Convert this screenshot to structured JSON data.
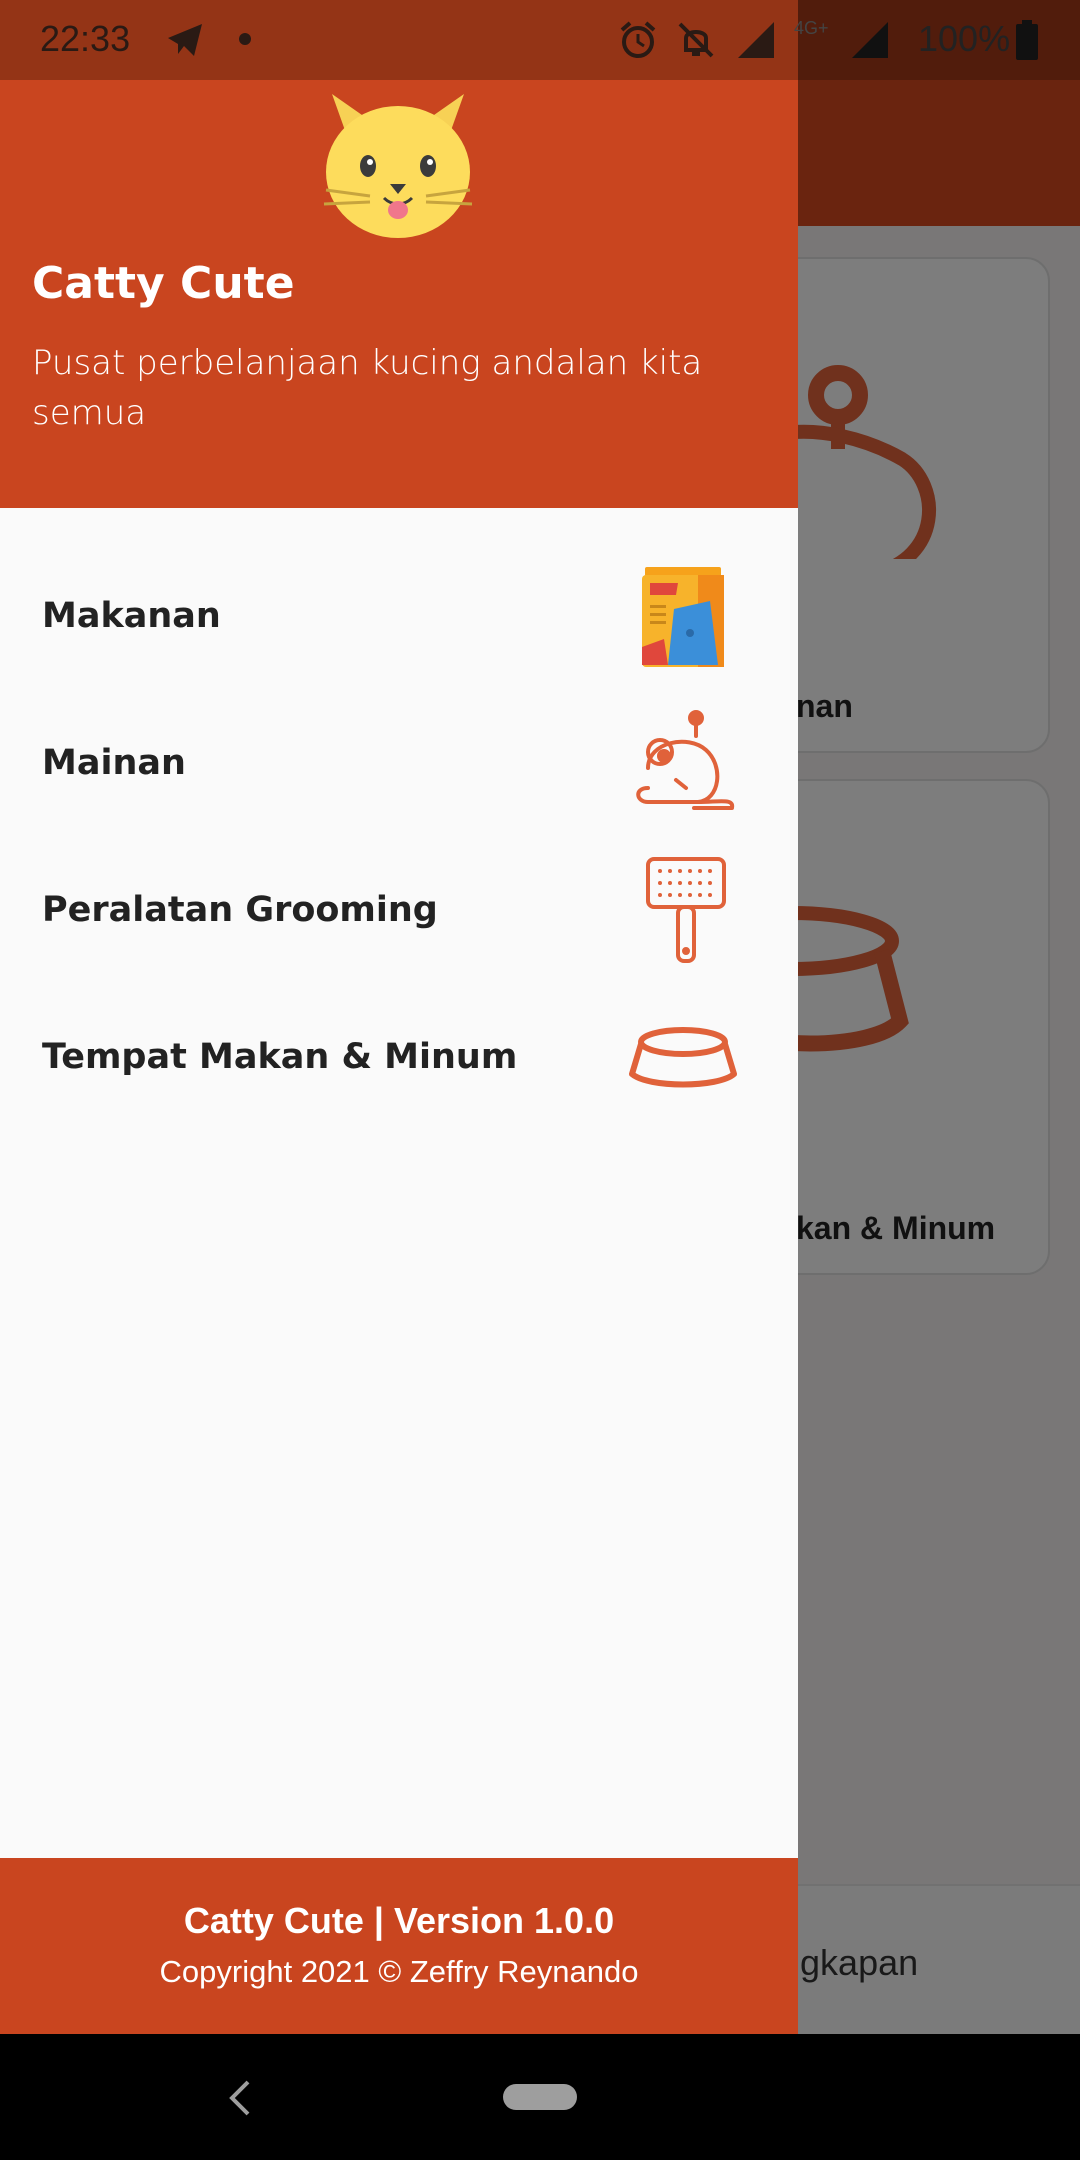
{
  "status_bar": {
    "time": "22:33",
    "network_type": "4G+",
    "battery": "100%",
    "icons": [
      "telegram-icon",
      "notification-dot-icon",
      "alarm-icon",
      "notifications-off-icon",
      "signal-icon",
      "signal-icon",
      "battery-icon"
    ]
  },
  "drawer": {
    "header": {
      "title": "Catty Cute",
      "subtitle": "Pusat perbelanjaan kucing andalan kita semua",
      "logo_icon": "cat-face-icon"
    },
    "menu": [
      {
        "label": "Makanan",
        "icon": "cat-food-bag-icon"
      },
      {
        "label": "Mainan",
        "icon": "toy-mouse-icon"
      },
      {
        "label": "Peralatan Grooming",
        "icon": "grooming-brush-icon"
      },
      {
        "label": "Tempat Makan & Minum",
        "icon": "pet-bowl-icon"
      }
    ],
    "footer": {
      "version": "Catty Cute | Version 1.0.0",
      "copyright": "Copyright 2021 © Zeffry Reynando"
    }
  },
  "background": {
    "card_1_label": "nan",
    "card_2_label": "kan & Minum",
    "bottom_label": "rlengkapan"
  },
  "colors": {
    "primary": "#c9451f",
    "icon_orange": "#e0623a",
    "text_dark": "#222222"
  },
  "nav_bar": {
    "buttons": [
      "back-icon",
      "home-pill-icon"
    ]
  }
}
